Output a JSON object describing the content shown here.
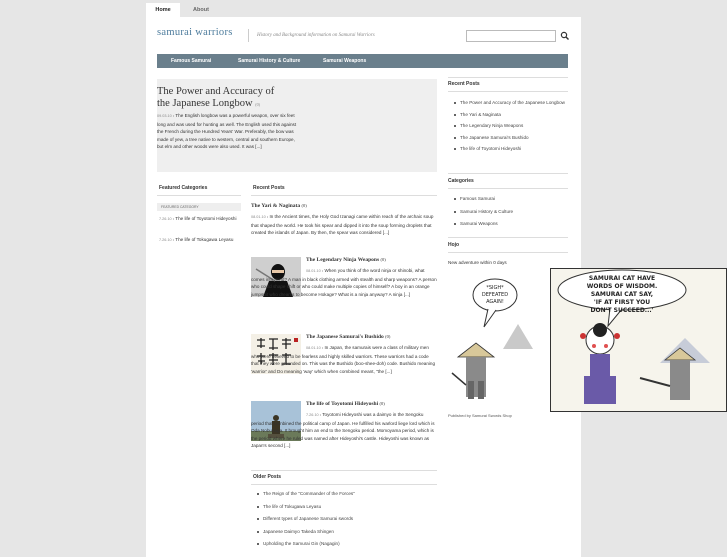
{
  "tabs": [
    {
      "label": "Home"
    },
    {
      "label": "About"
    }
  ],
  "site": {
    "title": "samurai warriors",
    "tagline": "History and Background information on Samurai Warriors",
    "search_placeholder": ""
  },
  "nav": [
    {
      "label": "Famous Samurai"
    },
    {
      "label": "Samurai History & Culture"
    },
    {
      "label": "Samurai Weapons"
    }
  ],
  "feature": {
    "title": "The Power and Accuracy of the Japanese Longbow",
    "count": "(0)",
    "date": "09.03.10 •",
    "text": "The English longbow was a powerful weapon, over six feet long and was used for hunting as well. The English used this against the French during the Hundred Years' War. Preferably, the bow was made of yew, a tree native to western, central and southern Europe, but elm and other woods were also used. It was [...]"
  },
  "featured": {
    "heading": "Featured Categories",
    "subhead": "FEATURED CATEGORY",
    "items": [
      {
        "date": "7.26.10 •",
        "title": "The life of Toyotomi Hideyoshi"
      },
      {
        "date": "7.26.10 •",
        "title": "The life of Tokugawa Leyasu"
      }
    ]
  },
  "recent": {
    "heading": "Recent Posts",
    "posts": [
      {
        "title": "The Yari & Naginata",
        "count": "(0)",
        "date": "08.01.10 •",
        "text": "In the Ancient times, the Holy God Izanagi came within reach of the archaic soup that shaped the world. He took his spear and dipped it into the soup forming droplets that created the islands of Japan. By then, the spear was considered [...]"
      },
      {
        "title": "The Legendary Ninja Weapons",
        "count": "(0)",
        "date": "08.01.10 •",
        "text": "When you think of the word ninja or shinobi, what comes into mind? A man in black clothing armed with stealth and sharp weapons? A person who could shape shift or who could make multiple copies of himself? A boy in an orange jumpsuit who dreams to become Hokage? What is a ninja anyway? A ninja [...]"
      },
      {
        "title": "The Japanese Samurai's Bushido",
        "count": "(0)",
        "date": "08.01.10 •",
        "text": "In Japan, the samurais were a class of military men who were believed to be fearless and highly skilled warriors. These warriors had a code that they were grounded on. This was the Bushido (boo-shee-doh) code. Bushido meaning 'warrior' and Do meaning 'way' which when combined meant, \"the [...]"
      },
      {
        "title": "The life of Toyotomi Hideyoshi",
        "count": "(0)",
        "date": "7.26.10 •",
        "text": "Toyotomi Hideyoshi was a daimyo in the Sengoku period that combined the political camp of Japan. He fulfilled his warlord liege lord which is Oda Nobunaga. It brought him an end to the Sengoku period. Momoyama period, which is the period where he ruled was named after Hideyoshi's castle. Hideyoshi was known as Japan's second [...]"
      }
    ]
  },
  "older": {
    "heading": "Older Posts",
    "items": [
      "The Reign of the \"Commander of the Forces\"",
      "The life of Tokugawa Leyasu",
      "Different types of Japanese Samurai swords",
      "Japanese Daimyo Takeda Shingen",
      "Upholding the Samurai Gin (Nagagin)"
    ]
  },
  "right_recent": {
    "heading": "Recent Posts",
    "items": [
      "The Power and Accuracy of the Japanese Longbow",
      "The Yari & Naginata",
      "The Legendary Ninja Weapons",
      "The Japanese Samurai's Bushido",
      "The life of Toyotomi Hideyoshi"
    ]
  },
  "categories": {
    "heading": "Categories",
    "items": [
      "Famous Samurai",
      "Samurai History & Culture",
      "Samurai Weapons"
    ]
  },
  "hojo": {
    "heading": "Hojo",
    "subtitle": "New adventure within 0 days",
    "caption": "Published by Samurai Swords Shop"
  },
  "comic": {
    "bubble1": "*SIGH* DEFEATED AGAIN!",
    "bubble2": "SAMURAI CAT HAVE WORDS OF WISDOM. SAMURAI CAT SAY, 'IF AT FIRST YOU DON'T SUCCEED...'"
  },
  "colors": {
    "accent": "#4c7b9c",
    "nav_bg": "#6a7f8c",
    "page_bg": "#e6e6e6"
  }
}
